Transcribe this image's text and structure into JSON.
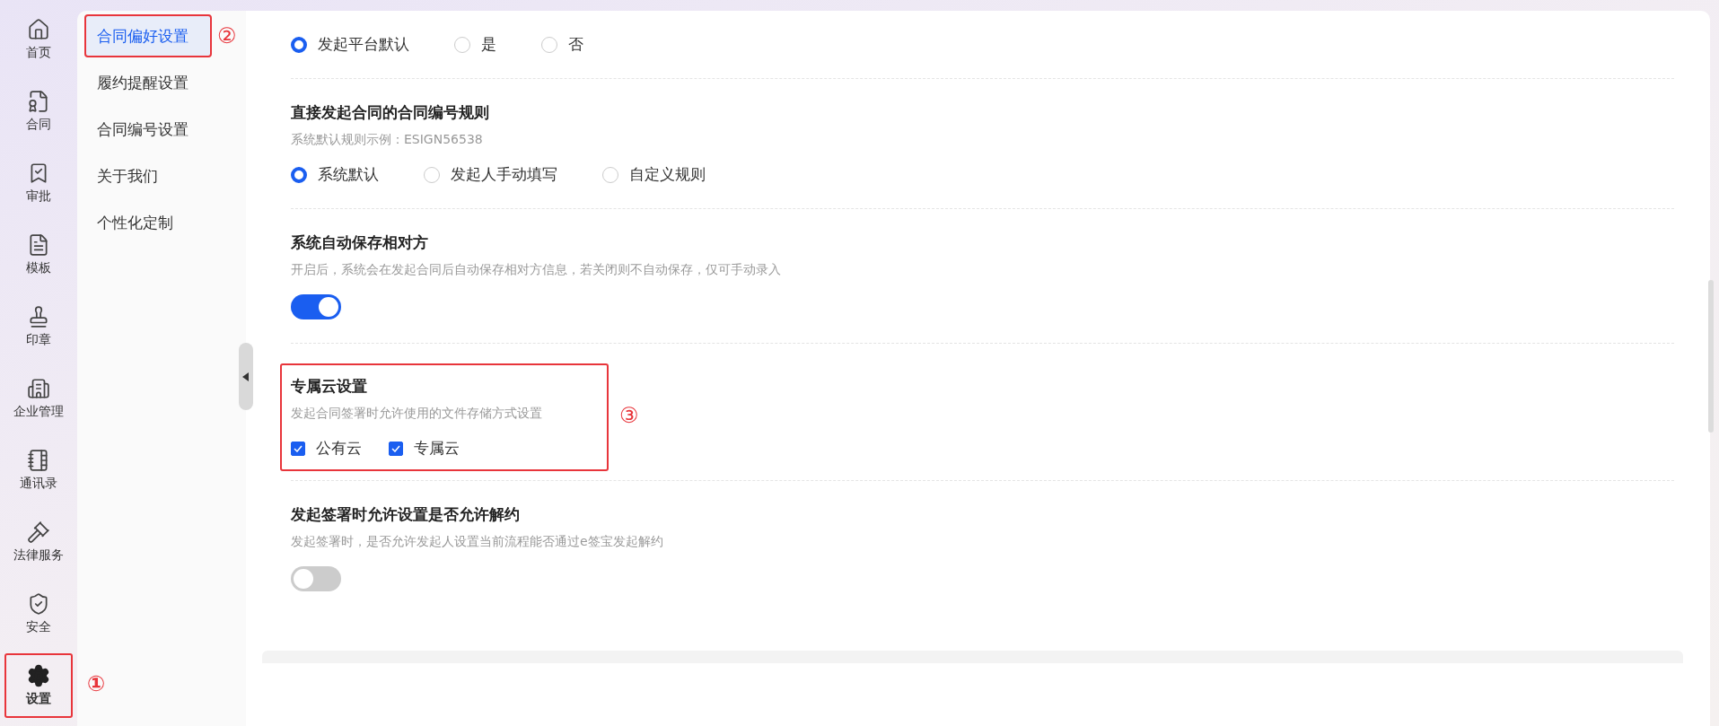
{
  "nav": {
    "annotation": "①",
    "items": [
      {
        "label": "首页",
        "selected": false,
        "highlighted": false
      },
      {
        "label": "合同",
        "selected": false,
        "highlighted": false
      },
      {
        "label": "审批",
        "selected": false,
        "highlighted": false
      },
      {
        "label": "模板",
        "selected": false,
        "highlighted": false
      },
      {
        "label": "印章",
        "selected": false,
        "highlighted": false
      },
      {
        "label": "企业管理",
        "selected": false,
        "highlighted": false
      },
      {
        "label": "通讯录",
        "selected": false,
        "highlighted": false
      },
      {
        "label": "法律服务",
        "selected": false,
        "highlighted": false
      },
      {
        "label": "安全",
        "selected": false,
        "highlighted": false
      },
      {
        "label": "设置",
        "selected": true,
        "highlighted": true
      }
    ]
  },
  "submenu": {
    "annotation": "②",
    "items": [
      {
        "label": "合同偏好设置",
        "selected": true,
        "highlighted": true
      },
      {
        "label": "履约提醒设置",
        "selected": false,
        "highlighted": false
      },
      {
        "label": "合同编号设置",
        "selected": false,
        "highlighted": false
      },
      {
        "label": "关于我们",
        "selected": false,
        "highlighted": false
      },
      {
        "label": "个性化定制",
        "selected": false,
        "highlighted": false
      }
    ]
  },
  "sections": [
    {
      "kind": "radio",
      "options": [
        {
          "label": "发起平台默认",
          "selected": true
        },
        {
          "label": "是",
          "selected": false
        },
        {
          "label": "否",
          "selected": false
        }
      ]
    },
    {
      "kind": "radio",
      "title": "直接发起合同的合同编号规则",
      "description": "系统默认规则示例：ESIGN56538",
      "options": [
        {
          "label": "系统默认",
          "selected": true
        },
        {
          "label": "发起人手动填写",
          "selected": false
        },
        {
          "label": "自定义规则",
          "selected": false
        }
      ]
    },
    {
      "kind": "toggle",
      "title": "系统自动保存相对方",
      "description": "开启后，系统会在发起合同后自动保存相对方信息，若关闭则不自动保存，仅可手动录入",
      "on": true
    },
    {
      "kind": "checkbox",
      "highlighted": true,
      "annotation": "③",
      "title": "专属云设置",
      "description": "发起合同签署时允许使用的文件存储方式设置",
      "options": [
        {
          "label": "公有云",
          "checked": true
        },
        {
          "label": "专属云",
          "checked": true
        }
      ]
    },
    {
      "kind": "toggle",
      "title": "发起签署时允许设置是否允许解约",
      "description": "发起签署时，是否允许发起人设置当前流程能否通过e签宝发起解约",
      "on": false
    }
  ]
}
